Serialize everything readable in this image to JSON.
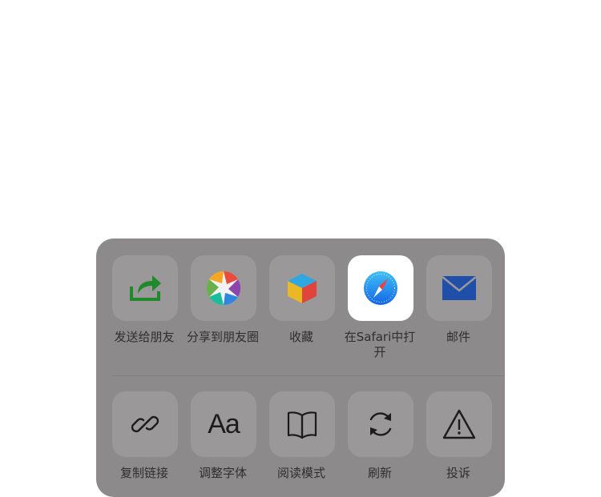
{
  "share_sheet": {
    "row1": [
      {
        "label": "发送给朋友",
        "icon": "share-arrow-icon"
      },
      {
        "label": "分享到朋友圈",
        "icon": "moments-aperture-icon"
      },
      {
        "label": "收藏",
        "icon": "favorite-cube-icon"
      },
      {
        "label": "在Safari中打开",
        "icon": "safari-compass-icon"
      },
      {
        "label": "邮件",
        "icon": "mail-envelope-icon"
      }
    ],
    "row2": [
      {
        "label": "复制链接",
        "icon": "link-icon"
      },
      {
        "label": "调整字体",
        "icon": "font-size-icon",
        "glyph": "Aa"
      },
      {
        "label": "阅读模式",
        "icon": "book-icon"
      },
      {
        "label": "刷新",
        "icon": "refresh-icon"
      },
      {
        "label": "投诉",
        "icon": "warning-icon"
      }
    ]
  },
  "colors": {
    "sheet_bg": "#8c8a8b",
    "tile_bg": "#9a9899",
    "share_green": "#1f8a2c",
    "mail_blue": "#1f4fa8",
    "safari_blue": "#1a8cf0"
  }
}
